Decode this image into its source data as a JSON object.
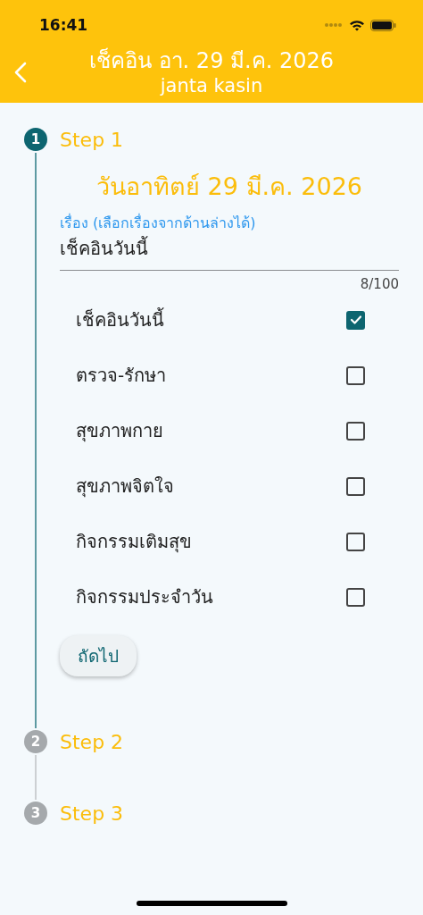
{
  "status_bar": {
    "time": "16:41"
  },
  "header": {
    "title": "เช็คอิน อา. 29 มี.ค. 2026",
    "subtitle": "janta kasin"
  },
  "steps": [
    {
      "number": "1",
      "label": "Step 1",
      "selected": true,
      "date": "วันอาทิตย์ 29 มี.ค. 2026",
      "field": {
        "label": "เรื่อง (เลือกเรื่องจากด้านล่างได้)",
        "value": "เช็คอินวันนี้",
        "counter": "8/100"
      },
      "options": [
        {
          "label": "เช็คอินวันนี้",
          "checked": true
        },
        {
          "label": "ตรวจ-รักษา",
          "checked": false
        },
        {
          "label": "สุขภาพกาย",
          "checked": false
        },
        {
          "label": "สุขภาพจิตใจ",
          "checked": false
        },
        {
          "label": "กิจกรรมเติมสุข",
          "checked": false
        },
        {
          "label": "กิจกรรมประจำวัน",
          "checked": false
        }
      ],
      "button": "ถัดไป"
    },
    {
      "number": "2",
      "label": "Step 2",
      "selected": false
    },
    {
      "number": "3",
      "label": "Step 3",
      "selected": false
    }
  ]
}
